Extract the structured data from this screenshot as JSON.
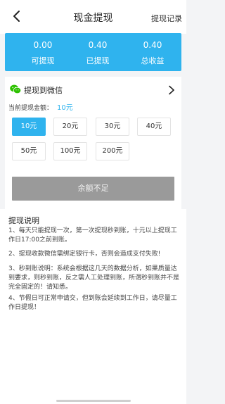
{
  "header": {
    "title": "现金提现",
    "record_link": "提现记录"
  },
  "stats": [
    {
      "value": "0.00",
      "label": "可提现"
    },
    {
      "value": "0.40",
      "label": "已提现"
    },
    {
      "value": "0.40",
      "label": "总收益"
    }
  ],
  "withdraw": {
    "method_label": "提现到微信",
    "amount_label": "当前提现金额：",
    "amount_value": "10元",
    "amounts": [
      "10元",
      "20元",
      "30元",
      "40元",
      "50元",
      "100元",
      "200元"
    ],
    "selected_index": 0,
    "submit_label": "余额不足"
  },
  "notes": {
    "title": "提现说明",
    "items": [
      "1、每天只能提现一次，第一次提现秒到账，十元以上提现工作日17:00之前到账。",
      "2、提现收款微信需绑定银行卡，否则会造成支付失败!",
      "3、秒到账说明：系统会根据这几天的数据分析，如果质量达到要求，则秒到账，反之需人工处理到账，所谓秒到账并不是完全固定的！请知悉。",
      "4、节假日可正常申请交，但到账会延续到工作日，请尽量工作日提现！"
    ]
  },
  "colors": {
    "accent": "#2fb3ee",
    "wechat_green": "#2dc100",
    "disabled_button": "#9a9a9a"
  }
}
